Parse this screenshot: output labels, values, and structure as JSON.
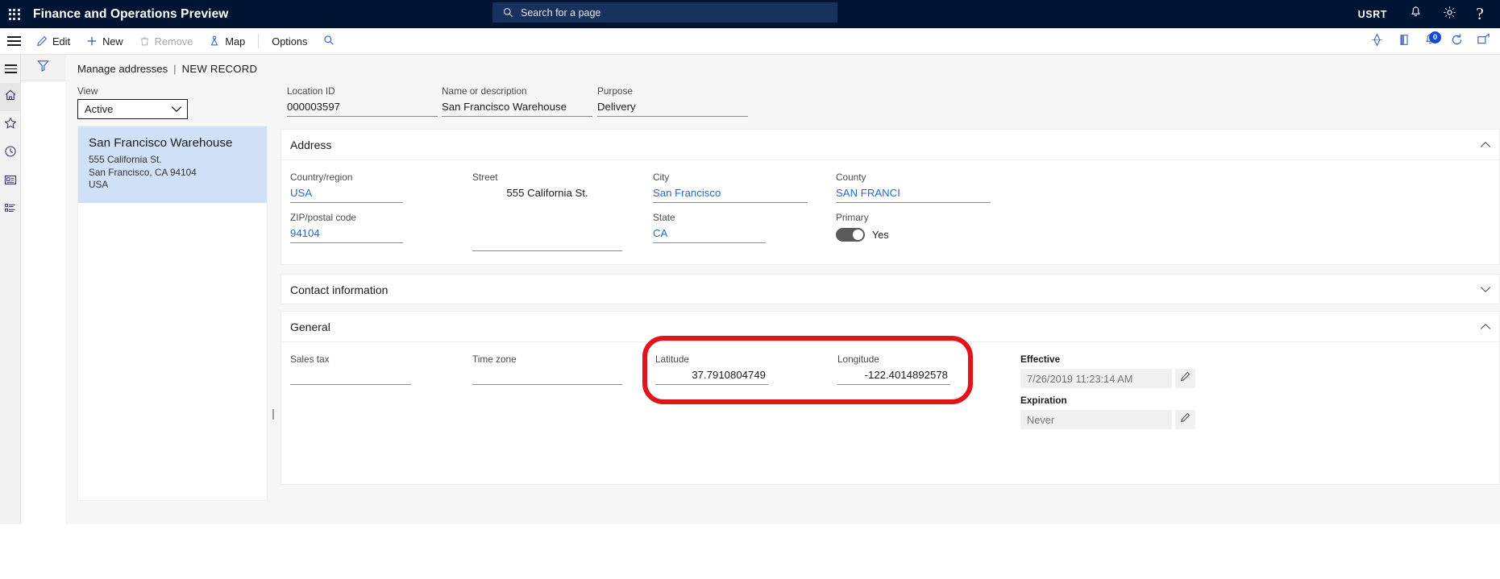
{
  "topbar": {
    "waffle_name": "app-launcher",
    "app_title": "Finance and Operations Preview",
    "search_placeholder": "Search for a page",
    "user_initials": "USRT",
    "notifications_icon": "bell-icon",
    "settings_icon": "gear-icon",
    "help_icon": "question-mark-icon",
    "bg_color": "#001433",
    "search_bg_color": "#17325c"
  },
  "commandbar": {
    "edit_label": "Edit",
    "new_label": "New",
    "remove_label": "Remove",
    "map_label": "Map",
    "options_label": "Options",
    "search_icon": "magnifier-icon",
    "right_icons": [
      {
        "name": "attachments-icon",
        "glyph": "diamond"
      },
      {
        "name": "open-in-new-window-icon",
        "glyph": "book"
      },
      {
        "name": "notifications-count-icon",
        "glyph": "bell",
        "badge": "0"
      },
      {
        "name": "refresh-icon",
        "glyph": "refresh"
      },
      {
        "name": "expand-icon",
        "glyph": "expand"
      }
    ],
    "badge_count": "0",
    "badge_color": "#0f4bd8"
  },
  "rail": {
    "items": [
      {
        "name": "hamburger-menu",
        "icon": "hamburger-icon"
      },
      {
        "name": "home",
        "icon": "home-icon"
      },
      {
        "name": "favorites",
        "icon": "star-icon"
      },
      {
        "name": "recent",
        "icon": "clock-icon"
      },
      {
        "name": "workspaces",
        "icon": "workspace-icon"
      },
      {
        "name": "modules",
        "icon": "list-icon"
      }
    ]
  },
  "filter": {
    "icon": "funnel-filter-icon"
  },
  "breadcrumb": {
    "page_name": "Manage addresses",
    "separator": "|",
    "record_status": "NEW RECORD"
  },
  "leftpanel": {
    "view_label": "View",
    "view_value": "Active",
    "view_options": [
      "Active"
    ],
    "chevron_icon": "chevron-down-icon",
    "card": {
      "title": "San Francisco Warehouse",
      "line1": "555 California St.",
      "line2": "San Francisco, CA 94104",
      "line3": "USA",
      "selected_bg": "#cfe0f7"
    }
  },
  "header_fields": [
    {
      "label": "Location ID",
      "value": "000003597"
    },
    {
      "label": "Name or description",
      "value": "San Francisco Warehouse"
    },
    {
      "label": "Purpose",
      "value": "Delivery"
    }
  ],
  "sections": {
    "address": {
      "title": "Address",
      "collapse_icon": "chevron-up-icon",
      "fields": [
        {
          "label": "Country/region",
          "value": "USA",
          "style": "link"
        },
        {
          "label": "Street",
          "value": "555 California St.",
          "style": "plain"
        },
        {
          "label": "City",
          "value": "San Francisco",
          "style": "link"
        },
        {
          "label": "County",
          "value": "SAN FRANCI",
          "style": "link"
        },
        {
          "label": "ZIP/postal code",
          "value": "94104",
          "style": "link"
        },
        {
          "label": "State",
          "value": "CA",
          "style": "link"
        }
      ],
      "primary": {
        "label": "Primary",
        "toggle_state": "on",
        "toggle_value": "Yes"
      }
    },
    "contact": {
      "title": "Contact information",
      "collapse_icon": "chevron-down-icon"
    },
    "general": {
      "title": "General",
      "collapse_icon": "chevron-up-icon",
      "fields": [
        {
          "label": "Sales tax",
          "value": "",
          "style": "link"
        },
        {
          "label": "Time zone",
          "value": "",
          "style": "link"
        },
        {
          "label": "Latitude",
          "value": "37.7910804749",
          "style": "num"
        },
        {
          "label": "Longitude",
          "value": "-122.4014892578",
          "style": "num"
        }
      ],
      "effective": {
        "label": "Effective",
        "value": "7/26/2019 11:23:14 AM",
        "edit_icon": "pencil-icon"
      },
      "expiration": {
        "label": "Expiration",
        "value": "Never",
        "edit_icon": "pencil-icon"
      }
    }
  },
  "annotation": {
    "name": "latitude-longitude-highlight",
    "color": "#e3131c",
    "shape": "rounded-rectangle"
  }
}
